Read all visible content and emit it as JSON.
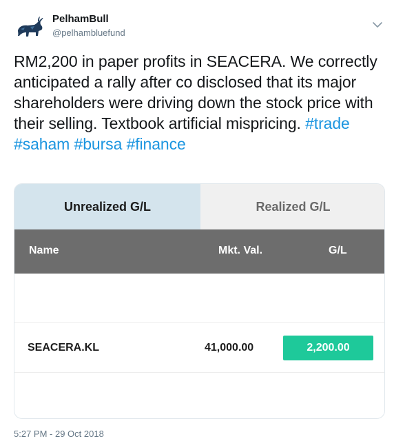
{
  "tweet": {
    "display_name": "PelhamBull",
    "handle": "@pelhambluefund",
    "text_plain": "RM2,200 in paper profits in SEACERA. We correctly anticipated a rally after co disclosed that its major shareholders were driving down the stock price with their selling. Textbook artificial mispricing. ",
    "hashtags": [
      "#trade",
      "#saham",
      "#bursa",
      "#finance"
    ],
    "timestamp": "5:27 PM - 29 Oct 2018",
    "link_color": "#1b95e0"
  },
  "card": {
    "tabs": [
      {
        "label": "Unrealized G/L",
        "active": true
      },
      {
        "label": "Realized G/L",
        "active": false
      }
    ],
    "columns": [
      "Name",
      "Mkt. Val.",
      "G/L"
    ],
    "rows": [
      {
        "name": "SEACERA.KL",
        "mkt_val": "41,000.00",
        "gl": "2,200.00"
      }
    ],
    "gain_color": "#1ec99a"
  }
}
